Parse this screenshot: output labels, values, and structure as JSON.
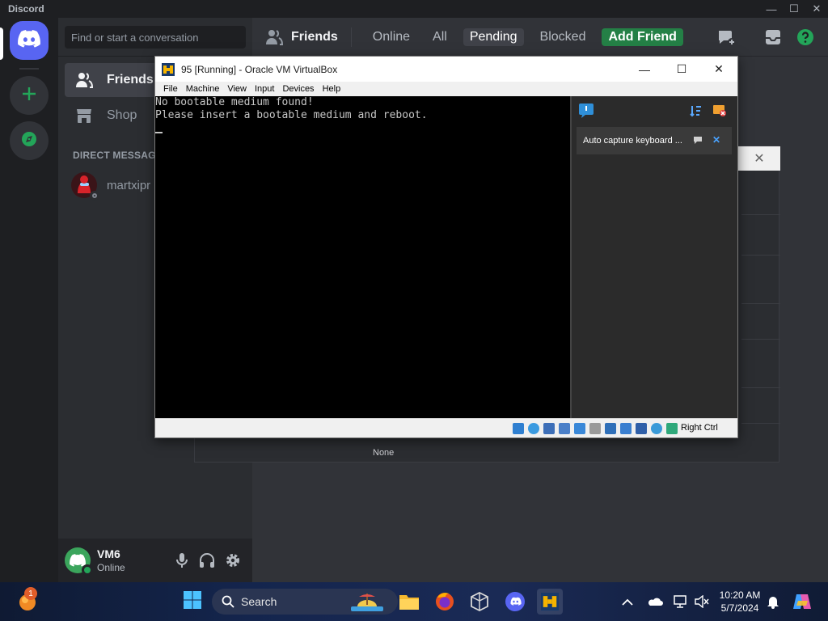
{
  "window": {
    "title": "Discord",
    "minimize": "—",
    "maximize": "☐",
    "close": "✕"
  },
  "sidebar": {
    "search_placeholder": "Find or start a conversation",
    "nav": [
      {
        "label": "Friends",
        "icon": "friends-icon",
        "active": true
      },
      {
        "label": "Shop",
        "icon": "shop-icon",
        "active": false
      }
    ],
    "dm_header": "DIRECT MESSAGES",
    "dms": [
      {
        "name": "martxipr",
        "status": "offline"
      }
    ]
  },
  "user_panel": {
    "username": "VM6",
    "status": "Online"
  },
  "topbar": {
    "title": "Friends",
    "tabs": [
      {
        "label": "Online",
        "active": false
      },
      {
        "label": "All",
        "active": false
      },
      {
        "label": "Pending",
        "active": true
      },
      {
        "label": "Blocked",
        "active": false
      }
    ],
    "add_friend": "Add Friend"
  },
  "background_dialog": {
    "close": "✕",
    "value_text": "None"
  },
  "vbox": {
    "title": "95 [Running] - Oracle VM VirtualBox",
    "minimize": "—",
    "maximize": "☐",
    "close": "✕",
    "menu": [
      "File",
      "Machine",
      "View",
      "Input",
      "Devices",
      "Help"
    ],
    "screen_lines": [
      "No bootable medium found!",
      "Please insert a bootable medium and reboot."
    ],
    "notification": "Auto capture keyboard ...",
    "notification_close": "✕",
    "host_key": "Right Ctrl"
  },
  "taskbar": {
    "search_label": "Search",
    "notification_badge": "1",
    "time": "10:20 AM",
    "date": "5/7/2024"
  },
  "colors": {
    "discord_blurple": "#5865f2",
    "discord_green": "#248046",
    "discord_bg": "#313338"
  }
}
